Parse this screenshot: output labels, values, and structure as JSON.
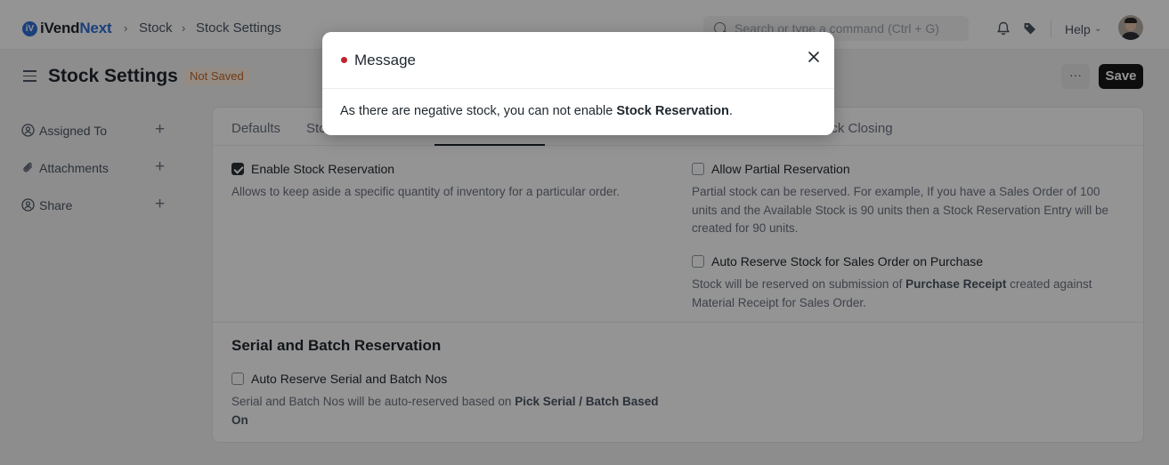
{
  "navbar": {
    "logo_prefix": "iVend",
    "logo_suffix": "Next",
    "logo_mark": "iV",
    "breadcrumbs": [
      "Stock",
      "Stock Settings"
    ],
    "search_placeholder": "Search or type a command (Ctrl + G)",
    "help_label": "Help",
    "icons": [
      "search-icon",
      "bell-icon",
      "tag-icon",
      "chevron-down-icon"
    ]
  },
  "page": {
    "title": "Stock Settings",
    "status": "Not Saved",
    "more_label": "···",
    "save_label": "Save"
  },
  "sidebar": {
    "items": [
      {
        "label": "Assigned To",
        "icon": "assign-user-icon"
      },
      {
        "label": "Attachments",
        "icon": "paperclip-icon"
      },
      {
        "label": "Share",
        "icon": "share-user-icon"
      }
    ]
  },
  "tabs": {
    "defaults": "Defaults",
    "partial_left": "Sto",
    "partial_right": "ock Closing"
  },
  "settings": {
    "enable_reservation": {
      "label": "Enable Stock Reservation",
      "checked": true,
      "description": "Allows to keep aside a specific quantity of inventory for a particular order."
    },
    "allow_partial": {
      "label": "Allow Partial Reservation",
      "checked": false,
      "description": "Partial stock can be reserved. For example, If you have a Sales Order of 100 units and the Available Stock is 90 units then a Stock Reservation Entry will be created for 90 units."
    },
    "auto_reserve_purchase": {
      "label": "Auto Reserve Stock for Sales Order on Purchase",
      "checked": false,
      "description_pre": "Stock will be reserved on submission of ",
      "description_bold": "Purchase Receipt",
      "description_post": " created against Material Receipt for Sales Order."
    },
    "serial_section_title": "Serial and Batch Reservation",
    "auto_reserve_serial": {
      "label": "Auto Reserve Serial and Batch Nos",
      "checked": false,
      "description_pre": "Serial and Batch Nos will be auto-reserved based on ",
      "description_bold": "Pick Serial / Batch Based On"
    }
  },
  "modal": {
    "title": "Message",
    "indicator_color": "#c0232b",
    "body_pre": "As there are negative stock, you can not enable ",
    "body_bold": "Stock Reservation",
    "body_post": "."
  }
}
